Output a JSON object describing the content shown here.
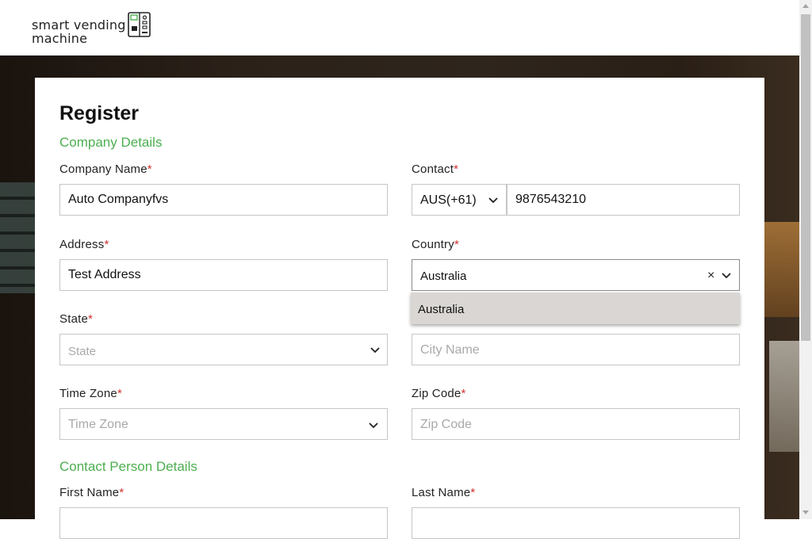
{
  "header": {
    "logo_line1": "smart vending",
    "logo_line2": "machine"
  },
  "form": {
    "title": "Register",
    "company_section": "Company Details",
    "contact_section": "Contact Person Details",
    "company_name": {
      "label": "Company Name",
      "value": "Auto Companyfvs"
    },
    "contact": {
      "label": "Contact",
      "code": "AUS(+61)",
      "value": "9876543210"
    },
    "address": {
      "label": "Address",
      "value": "Test Address"
    },
    "country": {
      "label": "Country",
      "value": "Australia",
      "clear": "×"
    },
    "country_dropdown": {
      "options": [
        "Australia"
      ]
    },
    "state": {
      "label": "State",
      "placeholder": "State"
    },
    "city": {
      "placeholder": "City Name"
    },
    "time_zone": {
      "label": "Time Zone",
      "placeholder": "Time Zone"
    },
    "zip": {
      "label": "Zip Code",
      "placeholder": "Zip Code"
    },
    "first_name": {
      "label": "First Name"
    },
    "last_name": {
      "label": "Last Name"
    },
    "required_mark": "*"
  },
  "colors": {
    "section": "#4caf50",
    "required": "#d32f2f"
  }
}
